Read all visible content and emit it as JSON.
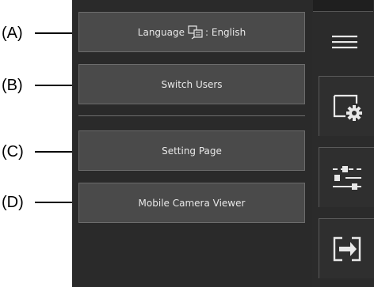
{
  "callouts": [
    "(A)",
    "(B)",
    "(C)",
    "(D)"
  ],
  "menu": {
    "language_label": "Language",
    "language_value": ": English",
    "switch_users_label": "Switch Users",
    "setting_page_label": "Setting Page",
    "mobile_camera_viewer_label": "Mobile Camera Viewer"
  },
  "rail_icons": [
    "hamburger-menu-icon",
    "settings-gear-icon",
    "sliders-icon",
    "logout-icon"
  ],
  "colors": {
    "panel": "#2a2a2a",
    "button": "#4a4a4a",
    "text": "#e8e8e8"
  }
}
